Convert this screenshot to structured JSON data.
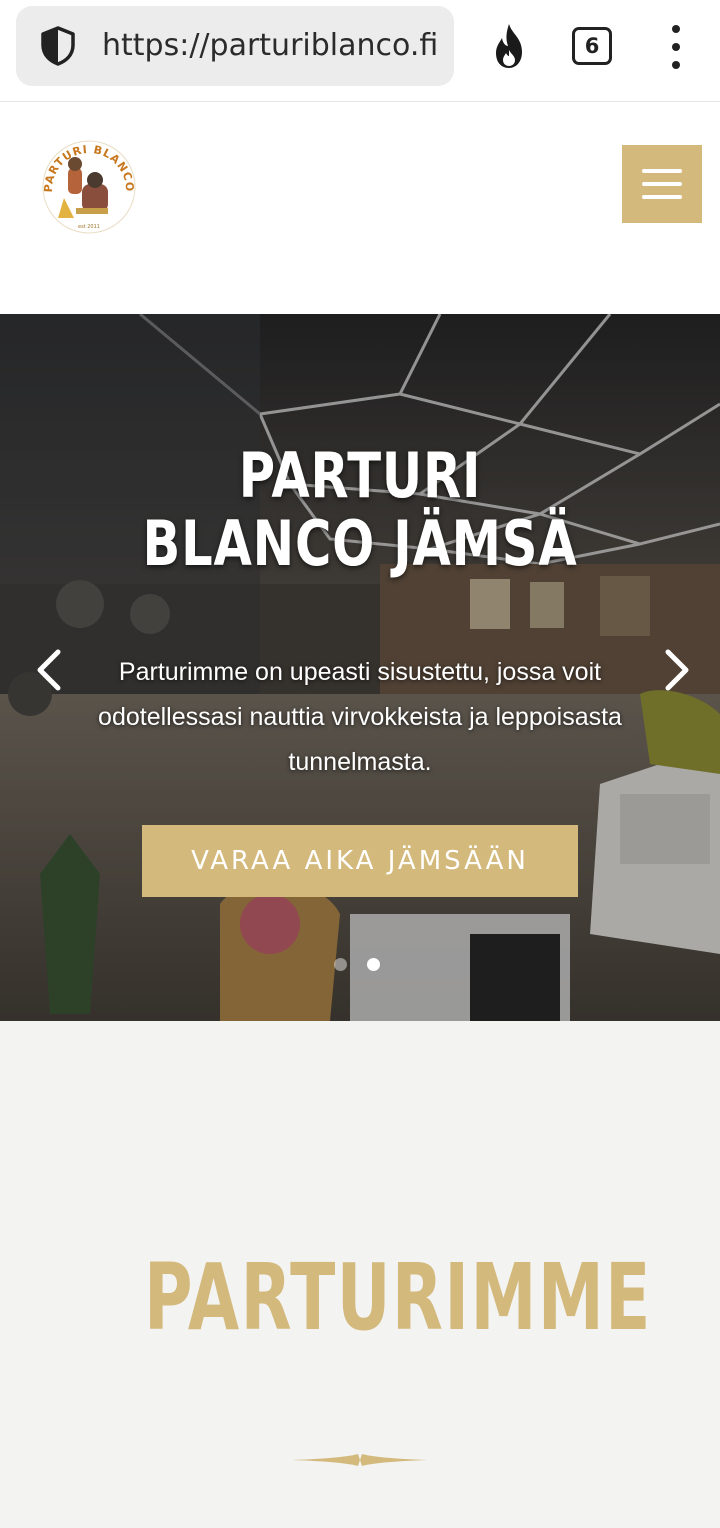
{
  "browser": {
    "url": "https://parturiblanco.fi",
    "tab_count": "6",
    "icons": [
      "shield-icon",
      "fire-icon",
      "tabs-icon",
      "more-vert-icon"
    ]
  },
  "header": {
    "logo_text": "PARTURI BLANCO",
    "logo_est": "est 2011",
    "menu_icon": "hamburger-icon"
  },
  "hero": {
    "title": "PARTURI BLANCO JÄMSÄ",
    "text": "Parturimme on upeasti sisustettu, jossa voit odotellessasi  nauttia virvokkeista ja leppoisasta tunnelmasta.",
    "cta_label": "VARAA AIKA JÄMSÄÄN",
    "slides": 2,
    "active_slide": 2
  },
  "section": {
    "title": "PARTURIMME"
  },
  "colors": {
    "accent": "#d4b97c",
    "section_bg": "#f3f3f2"
  }
}
